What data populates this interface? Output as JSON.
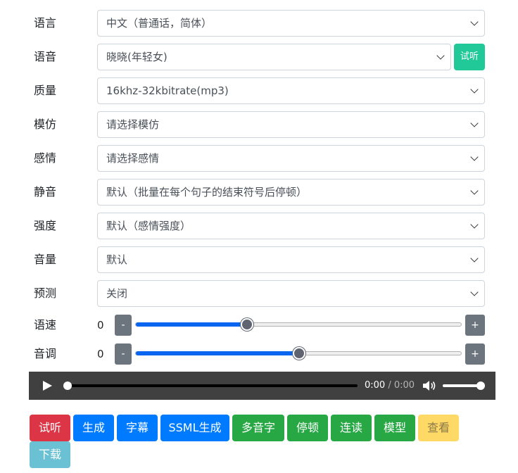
{
  "form": {
    "language": {
      "label": "语言",
      "value": "中文（普通话，简体）"
    },
    "voice": {
      "label": "语音",
      "value": "晓晓(年轻女)",
      "try_label": "试听"
    },
    "quality": {
      "label": "质量",
      "value": "16khz-32kbitrate(mp3)"
    },
    "imitate": {
      "label": "模仿",
      "value": "请选择模仿"
    },
    "emotion": {
      "label": "感情",
      "value": "请选择感情"
    },
    "silence": {
      "label": "静音",
      "value": "默认（批量在每个句子的结束符号后停顿）"
    },
    "intensity": {
      "label": "强度",
      "value": "默认（感情强度）"
    },
    "volume": {
      "label": "音量",
      "value": "默认"
    },
    "predict": {
      "label": "预测",
      "value": "关闭"
    }
  },
  "sliders": {
    "rate": {
      "label": "语速",
      "value": "0",
      "minus": "-",
      "plus": "+",
      "fraction": 0.34
    },
    "pitch": {
      "label": "音调",
      "value": "0",
      "minus": "-",
      "plus": "+",
      "fraction": 0.5
    }
  },
  "player": {
    "current": "0:00",
    "separator": "/",
    "duration": "0:00",
    "progress": 0,
    "volume": 1.0,
    "play_icon": "play-icon",
    "volume_icon": "speaker-icon"
  },
  "actions": {
    "try_listen": "试听",
    "generate": "生成",
    "subtitle": "字幕",
    "ssml_generate": "SSML生成",
    "polyphone": "多音字",
    "pause": "停顿",
    "continuous": "连读",
    "model": "模型",
    "view": "查看",
    "download": "下载"
  },
  "colors": {
    "danger": "#dc3545",
    "primary": "#007bff",
    "success": "#28a745",
    "warning": "#ffd966",
    "info": "#6ac1d3",
    "teal": "#20c997",
    "secondary": "#6c757d"
  }
}
